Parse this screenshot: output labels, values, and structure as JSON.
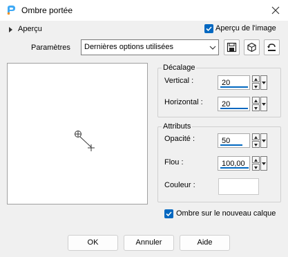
{
  "window": {
    "title": "Ombre portée"
  },
  "preview_toggle": {
    "label": "Aperçu"
  },
  "preview_on_image": {
    "label": "Aperçu de l'image",
    "checked": true
  },
  "presets": {
    "label": "Paramètres",
    "value": "Dernières options utilisées"
  },
  "offset": {
    "title": "Décalage",
    "vertical": {
      "label": "Vertical :",
      "value": "20"
    },
    "horizontal": {
      "label": "Horizontal :",
      "value": "20"
    }
  },
  "attributes": {
    "title": "Attributs",
    "opacity": {
      "label": "Opacité :",
      "value": "50"
    },
    "blur": {
      "label": "Flou :",
      "value": "100,00"
    },
    "color": {
      "label": "Couleur :",
      "value": "#ffffff"
    }
  },
  "new_layer": {
    "label": "Ombre sur le nouveau calque",
    "checked": true
  },
  "buttons": {
    "ok": "OK",
    "cancel": "Annuler",
    "help": "Aide"
  },
  "colors": {
    "accent": "#0067c0",
    "background": "#f0f0f0"
  }
}
